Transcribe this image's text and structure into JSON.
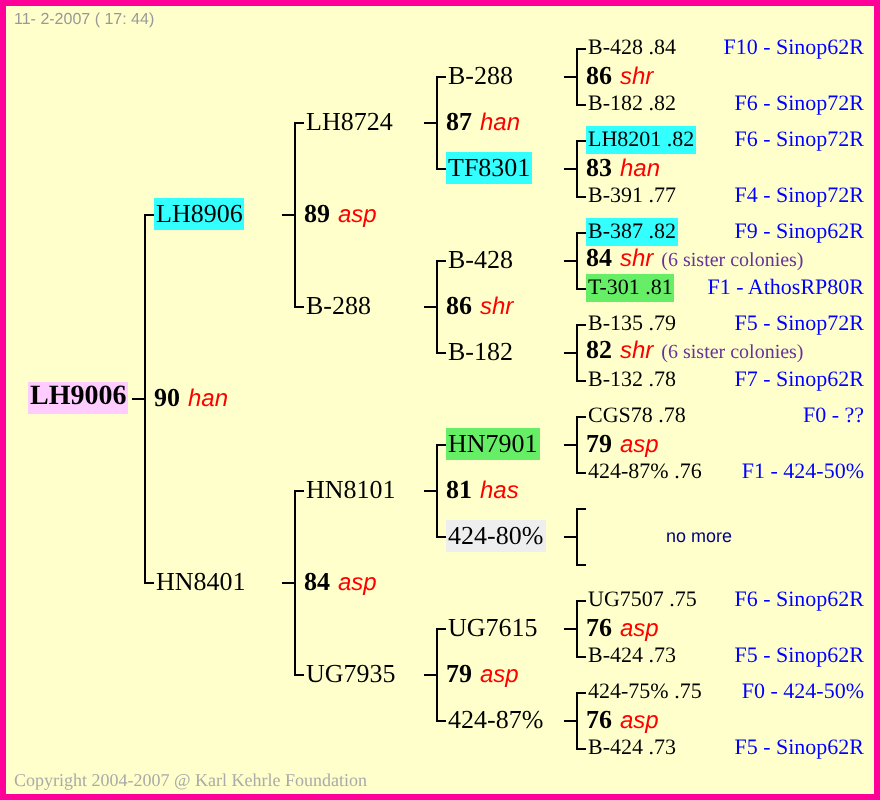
{
  "date": "11- 2-2007 ( 17: 44)",
  "tree": {
    "name": "LH9006",
    "color": "#ffccff",
    "mark": {
      "number": "90",
      "line": "han"
    },
    "children": [
      {
        "name": "LH8906",
        "color": "#33ffff",
        "mark": {
          "number": "89",
          "line": "asp"
        },
        "children": [
          {
            "name": "LH8724",
            "mark": {
              "number": "87",
              "line": "han"
            },
            "children": [
              {
                "name": "B-288",
                "mark": {
                  "number": "86",
                  "line": "shr"
                },
                "children": [
                  {
                    "label": "B-428 .84",
                    "origin": "F10 - Sinop62R"
                  },
                  {
                    "label": "B-182 .82",
                    "origin": "F6 - Sinop72R"
                  }
                ]
              },
              {
                "name": "TF8301",
                "color": "#33ffff",
                "mark": {
                  "number": "83",
                  "line": "han"
                },
                "children": [
                  {
                    "label": "LH8201 .82",
                    "color": "#33ffff",
                    "origin": "F6 - Sinop72R"
                  },
                  {
                    "label": "B-391 .77",
                    "origin": "F4 - Sinop72R"
                  }
                ]
              }
            ]
          },
          {
            "name": "B-288",
            "mark": {
              "number": "86",
              "line": "shr"
            },
            "children": [
              {
                "name": "B-428",
                "mark": {
                  "number": "84",
                  "line": "shr",
                  "note": "(6 sister colonies)"
                },
                "children": [
                  {
                    "label": "B-387 .82",
                    "color": "#33ffff",
                    "origin": "F9 - Sinop62R"
                  },
                  {
                    "label": "T-301 .81",
                    "color": "#66ee66",
                    "origin": "F1 - AthosRP80R"
                  }
                ]
              },
              {
                "name": "B-182",
                "mark": {
                  "number": "82",
                  "line": "shr",
                  "note": "(6 sister colonies)"
                },
                "children": [
                  {
                    "label": "B-135 .79",
                    "origin": "F5 - Sinop72R"
                  },
                  {
                    "label": "B-132 .78",
                    "origin": "F7 - Sinop62R"
                  }
                ]
              }
            ]
          }
        ]
      },
      {
        "name": "HN8401",
        "mark": {
          "number": "84",
          "line": "asp"
        },
        "children": [
          {
            "name": "HN8101",
            "mark": {
              "number": "81",
              "line": "has"
            },
            "children": [
              {
                "name": "HN7901",
                "color": "#66ee66",
                "mark": {
                  "number": "79",
                  "line": "asp"
                },
                "children": [
                  {
                    "label": "CGS78 .78",
                    "origin": "F0 - ??"
                  },
                  {
                    "label": "424-87% .76",
                    "origin": "F1 - 424-50%"
                  }
                ]
              },
              {
                "name": "424-80%",
                "color": "#eeeeee",
                "note": "no more"
              }
            ]
          },
          {
            "name": "UG7935",
            "mark": {
              "number": "79",
              "line": "asp"
            },
            "children": [
              {
                "name": "UG7615",
                "mark": {
                  "number": "76",
                  "line": "asp"
                },
                "children": [
                  {
                    "label": "UG7507 .75",
                    "origin": "F6 - Sinop62R"
                  },
                  {
                    "label": "B-424 .73",
                    "origin": "F5 - Sinop62R"
                  }
                ]
              },
              {
                "name": "424-87%",
                "mark": {
                  "number": "76",
                  "line": "asp"
                },
                "children": [
                  {
                    "label": "424-75% .75",
                    "origin": "F0 - 424-50%"
                  },
                  {
                    "label": "B-424 .73",
                    "origin": "F5 - Sinop62R"
                  }
                ]
              }
            ]
          }
        ]
      }
    ]
  },
  "copyright": "Copyright 2004-2007 @ Karl Kehrle Foundation"
}
